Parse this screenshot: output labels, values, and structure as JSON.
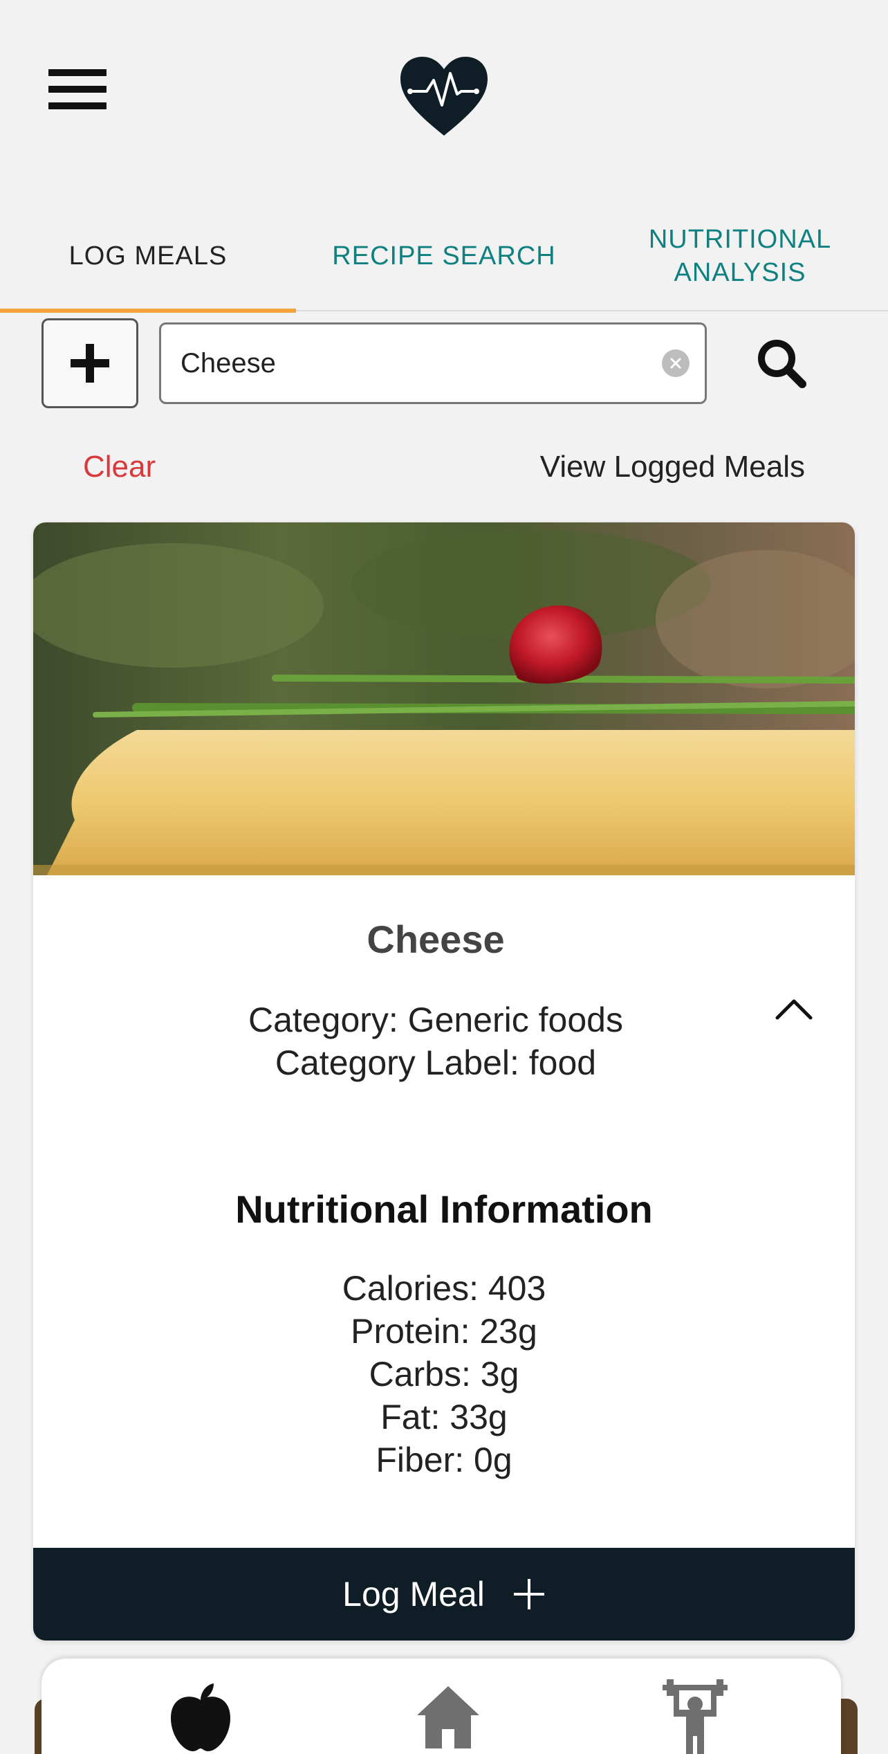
{
  "header": {
    "menu_icon": "hamburger-menu-icon",
    "logo_icon": "heart-pulse-icon"
  },
  "tabs": [
    {
      "label": "LOG MEALS",
      "active": true
    },
    {
      "label": "RECIPE SEARCH",
      "active": false
    },
    {
      "label": "NUTRITIONAL ANALYSIS",
      "active": false
    }
  ],
  "search": {
    "value": "Cheese",
    "add_icon": "plus-icon",
    "clear_icon": "clear-x-icon",
    "search_icon": "search-icon"
  },
  "actions": {
    "clear": "Clear",
    "view_logged": "View Logged Meals"
  },
  "result": {
    "title": "Cheese",
    "category": "Category: Generic foods",
    "category_label": "Category Label: food",
    "image_icon": "cheese-photo",
    "nutrition": {
      "heading": "Nutritional Information",
      "calories": "Calories: 403",
      "protein": "Protein: 23g",
      "carbs": "Carbs: 3g",
      "fat": "Fat: 33g",
      "fiber": "Fiber: 0g"
    },
    "log_button": "Log Meal"
  },
  "bottom_nav": [
    "apple-icon",
    "home-icon",
    "weightlifter-icon"
  ],
  "colors": {
    "accent": "#f4a23b",
    "teal": "#0f8080",
    "dark": "#0f1e26",
    "danger": "#d9393b"
  }
}
